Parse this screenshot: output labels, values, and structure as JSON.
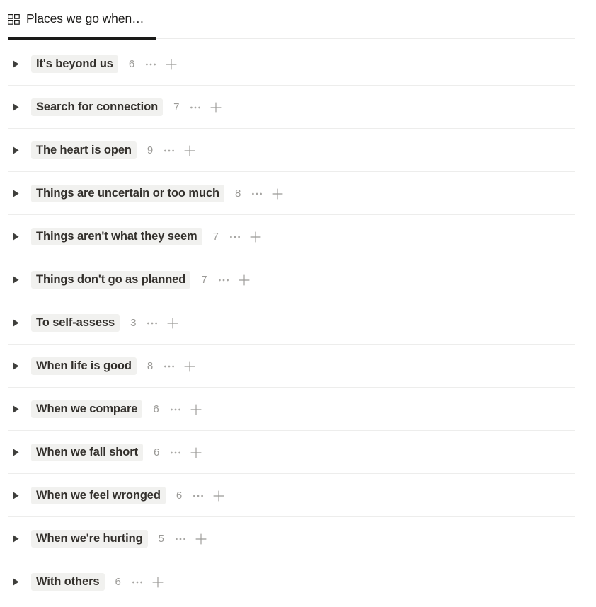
{
  "view": {
    "icon": "grid-gallery-icon",
    "title": "Places we go when…",
    "active": true
  },
  "colors": {
    "text_primary": "#33302c",
    "text_muted": "#9b9a97",
    "pill_background": "#f1f1ef",
    "divider": "#ededec",
    "tab_underline": "#1a1a18",
    "page_background": "#ffffff"
  },
  "row_controls": {
    "toggle_icon": "triangle-right-icon",
    "more_icon": "ellipsis-icon",
    "add_icon": "plus-icon"
  },
  "groups": [
    {
      "label": "It's beyond us",
      "count": "6"
    },
    {
      "label": "Search for connection",
      "count": "7"
    },
    {
      "label": "The heart is open",
      "count": "9"
    },
    {
      "label": "Things are uncertain or too much",
      "count": "8"
    },
    {
      "label": "Things aren't what they seem",
      "count": "7"
    },
    {
      "label": "Things don't go as planned",
      "count": "7"
    },
    {
      "label": "To self-assess",
      "count": "3"
    },
    {
      "label": "When life is good",
      "count": "8"
    },
    {
      "label": "When we compare",
      "count": "6"
    },
    {
      "label": "When we fall short",
      "count": "6"
    },
    {
      "label": "When we feel wronged",
      "count": "6"
    },
    {
      "label": "When we're hurting",
      "count": "5"
    },
    {
      "label": "With others",
      "count": "6"
    }
  ]
}
